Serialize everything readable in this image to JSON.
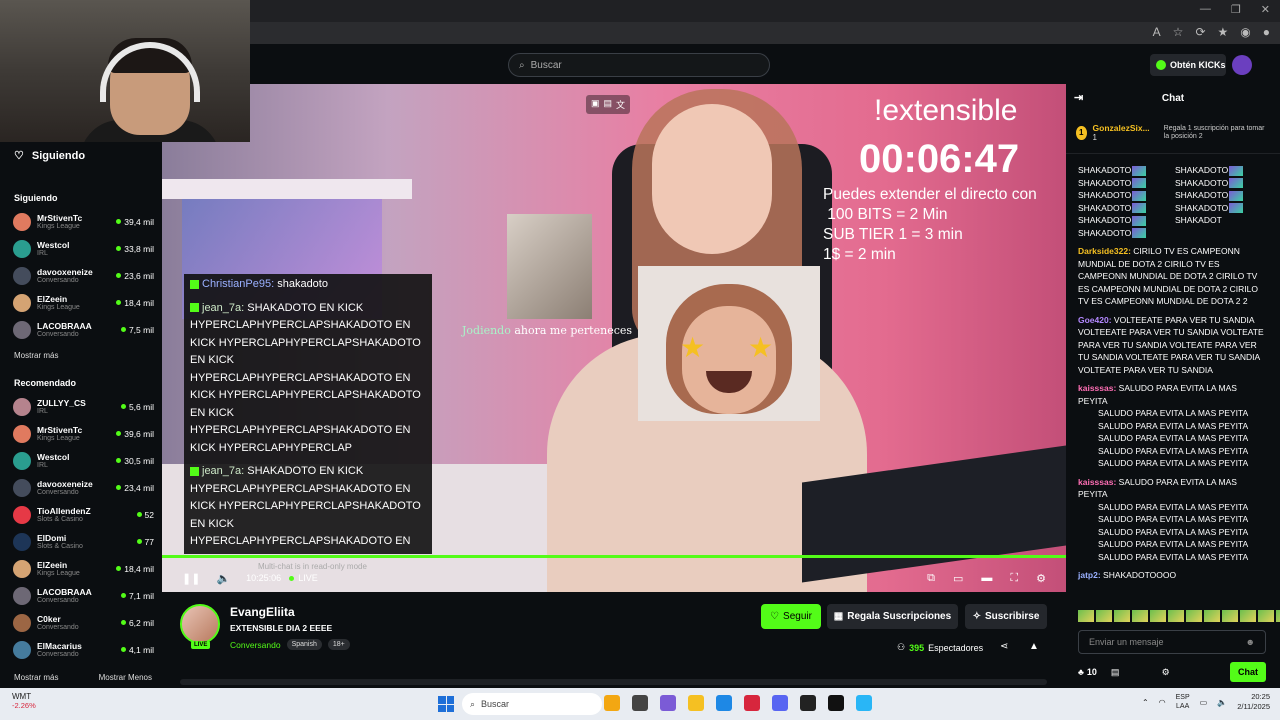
{
  "browser": {
    "window_controls": [
      "—",
      "❐",
      "✕"
    ],
    "address_icons": [
      "A",
      "☆",
      "⟳",
      "★",
      "◉",
      "●"
    ]
  },
  "kick": {
    "search_placeholder": "Buscar",
    "kicks_button": "Obtén KICKs"
  },
  "sidebar": {
    "following_title": "Siguiendo",
    "following_heading": "Siguiendo",
    "following": [
      {
        "name": "MrStivenTc",
        "category": "Kings League",
        "viewers": "39,4 mil",
        "color": "#e07a5f"
      },
      {
        "name": "Westcol",
        "category": "IRL",
        "viewers": "33,8 mil",
        "color": "#2a9d8f"
      },
      {
        "name": "davooxeneize",
        "category": "Conversando",
        "viewers": "23,6 mil",
        "color": "#444c5c"
      },
      {
        "name": "ElZeein",
        "category": "Kings League",
        "viewers": "18,4 mil",
        "color": "#d4a373"
      },
      {
        "name": "LACOBRAAA",
        "category": "Conversando",
        "viewers": "7,5 mil",
        "color": "#6d6875"
      }
    ],
    "show_more": "Mostrar más",
    "recommended_heading": "Recomendado",
    "recommended": [
      {
        "name": "ZULLYY_CS",
        "category": "IRL",
        "viewers": "5,6 mil",
        "color": "#b5838d"
      },
      {
        "name": "MrStivenTc",
        "category": "Kings League",
        "viewers": "39,6 mil",
        "color": "#e07a5f"
      },
      {
        "name": "Westcol",
        "category": "IRL",
        "viewers": "30,5 mil",
        "color": "#2a9d8f"
      },
      {
        "name": "davooxeneize",
        "category": "Conversando",
        "viewers": "23,4 mil",
        "color": "#444c5c"
      },
      {
        "name": "TioAllendenZ",
        "category": "Slots & Casino",
        "viewers": "52",
        "color": "#e63946"
      },
      {
        "name": "ElDomi",
        "category": "Slots & Casino",
        "viewers": "77",
        "color": "#1d3557"
      },
      {
        "name": "ElZeein",
        "category": "Kings League",
        "viewers": "18,4 mil",
        "color": "#d4a373"
      },
      {
        "name": "LACOBRAAA",
        "category": "Conversando",
        "viewers": "7,1 mil",
        "color": "#6d6875"
      },
      {
        "name": "C0ker",
        "category": "Conversando",
        "viewers": "6,2 mil",
        "color": "#9c6644"
      },
      {
        "name": "ElMacarius",
        "category": "Conversando",
        "viewers": "4,1 mil",
        "color": "#457b9d"
      }
    ],
    "footer_more": "Mostrar más",
    "footer_less": "Mostrar Menos"
  },
  "video": {
    "extensible_title": "!extensible",
    "timer": "00:06:47",
    "extend_lines": [
      "Puedes extender el directo con",
      " 100 BITS = 2 Min",
      "SUB TIER 1 = 3 min",
      "1$ = 2 min"
    ],
    "jodiendo_user": "Jodiendo",
    "jodiendo_text": " ahora me perteneces",
    "overlay_chat": [
      {
        "user": "ChristianPe95:",
        "text": " shakadoto",
        "user_color": "#9ab0ff"
      },
      {
        "user": "jean_7a:",
        "text": " SHAKADOTO EN KICK HYPERCLAPHYPERCLAPSHAKADOTO EN KICK HYPERCLAPHYPERCLAPSHAKADOTO EN KICK HYPERCLAPHYPERCLAPSHAKADOTO EN KICK HYPERCLAPHYPERCLAPSHAKADOTO EN KICK HYPERCLAPHYPERCLAPSHAKADOTO EN KICK HYPERCLAPHYPERCLAP",
        "user_color": "#cde8c7"
      },
      {
        "user": "jean_7a:",
        "text": " SHAKADOTO EN KICK HYPERCLAPHYPERCLAPSHAKADOTO EN KICK HYPERCLAPHYPERCLAPSHAKADOTO EN KICK HYPERCLAPHYPERCLAPSHAKADOTO EN KICK HYPERCLAPHYPERCLAPSHAKADOTO EN KICK HYPERCLAPHYPERCLAPSHAKADOTO EN KICK HYPERCLAPHYPERCLAP",
        "user_color": "#cde8c7"
      }
    ],
    "multichat_note": "Multi-chat is in read-only mode",
    "elapsed": "10:25:06",
    "live_label": "LIVE",
    "progress": 1.0
  },
  "stream": {
    "streamer": "EvangEliita",
    "live_badge": "LIVE",
    "title": "EXTENSIBLE DIA 2 EEEE",
    "category": "Conversando",
    "tags": [
      "Spanish",
      "18+"
    ],
    "follow_label": "Seguir",
    "gift_label": "Regala Suscripciones",
    "subscribe_label": "Suscribirse",
    "viewer_count": "395",
    "viewer_label": "Espectadores"
  },
  "chat": {
    "title": "Chat",
    "pinned_user": "GonzalezSix...",
    "pinned_rank": "1",
    "pinned_count": "1",
    "pinned_desc": "Regala 1 suscripción para tomar la posición 2",
    "shak_lines": [
      "SHAKADOTO",
      "SHAKADOTO",
      "SHAKADOTO",
      "SHAKADOTO",
      "SHAKADOTO",
      "SHAKADOTO",
      "SHAKADOTO",
      "SHAKADOTO",
      "SHAKADOTO",
      "SHAKADOTO",
      "SHAKADOT"
    ],
    "messages": [
      {
        "user": "Darkside322:",
        "color": "#f5c022",
        "text": " CIRILO TV ES CAMPEONN MUNDIAL DE DOTA 2 CIRILO TV ES CAMPEONN MUNDIAL DE DOTA 2 CIRILO TV ES CAMPEONN MUNDIAL DE DOTA 2 CIRILO TV ES CAMPEONN MUNDIAL DE DOTA 2 2"
      },
      {
        "user": "Goe420:",
        "color": "#b388ff",
        "text": " VOLTEEATE PARA VER TU SANDIA VOLTEEATE PARA VER TU SANDIA VOLTEATE PARA VER TU SANDIA VOLTEATE PARA VER TU SANDIA VOLTEATE PARA VER TU SANDIA VOLTEATE PARA VER TU SANDIA"
      },
      {
        "user": "kaisssas:",
        "color": "#ff6fb5",
        "text": " SALUDO PARA EVITA LA MAS PEYITA",
        "repeat": [
          "SALUDO PARA EVITA LA MAS PEYITA",
          "SALUDO PARA EVITA LA MAS PEYITA",
          "SALUDO PARA EVITA LA MAS PEYITA",
          "SALUDO PARA EVITA LA MAS PEYITA",
          "SALUDO PARA EVITA LA MAS PEYITA"
        ]
      },
      {
        "user": "kaisssas:",
        "color": "#ff6fb5",
        "text": " SALUDO PARA EVITA LA MAS PEYITA",
        "repeat": [
          "SALUDO PARA EVITA LA MAS PEYITA",
          "SALUDO PARA EVITA LA MAS PEYITA",
          "SALUDO PARA EVITA LA MAS PEYITA",
          "SALUDO PARA EVITA LA MAS PEYITA",
          "SALUDO PARA EVITA LA MAS PEYITA"
        ]
      },
      {
        "user": "jatp2:",
        "color": "#9ab0ff",
        "text": " SHAKADOTOOOO"
      }
    ],
    "input_placeholder": "Enviar un mensaje",
    "kicks_count": "10",
    "send_label": "Chat"
  },
  "taskbar": {
    "stock_name": "WMT",
    "stock_change": "-2.26%",
    "search_label": "Buscar",
    "lang_top": "ESP",
    "lang_bottom": "LAA",
    "time": "20:25",
    "date": "2/11/2025",
    "app_colors": [
      "#f3a712",
      "#444444",
      "#7b5bd6",
      "#f5c022",
      "#1e88e5",
      "#d7263d",
      "#5865f2",
      "#222222",
      "#111111",
      "#29b6f6"
    ]
  }
}
